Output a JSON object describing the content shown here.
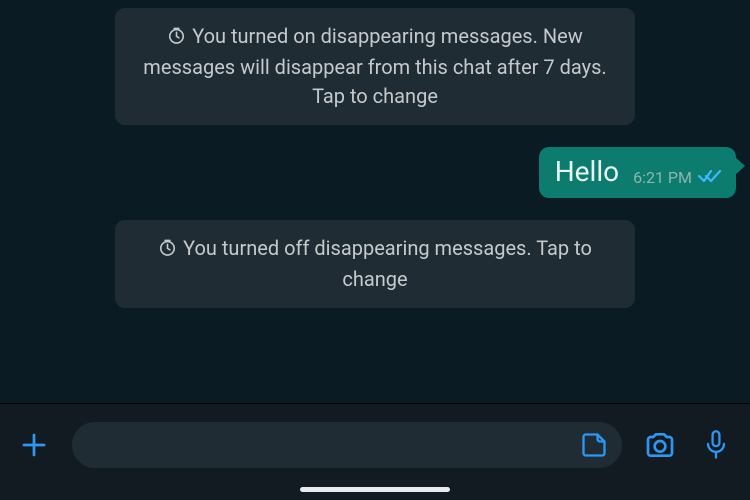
{
  "system_messages": [
    {
      "text": "You turned on disappearing messages. New messages will disappear from this chat after 7 days. Tap to change"
    },
    {
      "text": "You turned off disappearing messages. Tap to change"
    }
  ],
  "messages": [
    {
      "text": "Hello",
      "time": "6:21 PM",
      "status": "read"
    }
  ],
  "composer": {
    "placeholder": ""
  },
  "colors": {
    "accent": "#2f97f2",
    "outgoing_bubble": "#0b7c6e",
    "read_check": "#3fb7ff"
  }
}
